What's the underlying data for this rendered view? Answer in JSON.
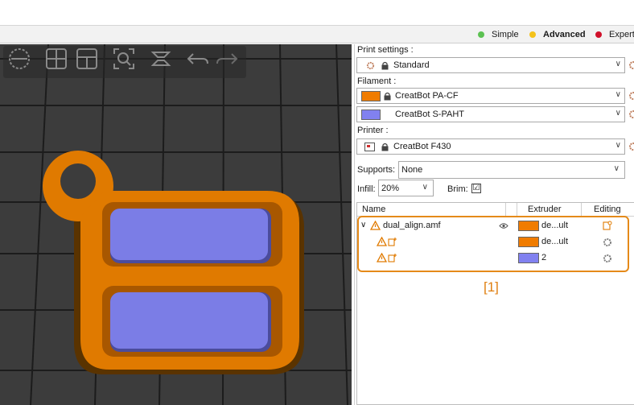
{
  "mode_bar": {
    "simple": {
      "label": "Simple",
      "color": "#5cc152"
    },
    "advanced": {
      "label": "Advanced",
      "color": "#f4c21a"
    },
    "expert": {
      "label": "Expert",
      "color": "#d0102a"
    }
  },
  "viewport": {
    "toolbar_icons": [
      "zoom-out-icon",
      "layout-grid-icon",
      "layout-split-icon",
      "zoom-to-fit-icon",
      "layers-icon",
      "undo-icon",
      "redo-icon"
    ],
    "colors": {
      "background": "#3c3c3c",
      "grid": "#1e1e1e",
      "part_orange": "#e07a00",
      "part_purple": "#7b7de6"
    }
  },
  "sidebar": {
    "print_settings": {
      "label": "Print settings :",
      "value": "Standard"
    },
    "filament": {
      "label": "Filament :",
      "items": [
        {
          "name": "CreatBot PA-CF",
          "color": "#f07c00"
        },
        {
          "name": "CreatBot S-PAHT",
          "color": "#8181f0"
        }
      ]
    },
    "printer": {
      "label": "Printer :",
      "value": "CreatBot F430"
    },
    "supports": {
      "label": "Supports:",
      "value": "None"
    },
    "infill": {
      "label": "Infill:",
      "value": "20%"
    },
    "brim": {
      "label": "Brim:",
      "checked": "☑"
    }
  },
  "object_list": {
    "columns": {
      "name": "Name",
      "extruder": "Extruder",
      "editing": "Editing"
    },
    "rows": [
      {
        "name": "dual_align.amf",
        "extruder": "de...ult",
        "color": "#f07c00"
      },
      {
        "name": "",
        "extruder": "de...ult",
        "color": "#f07c00"
      },
      {
        "name": "",
        "extruder": "2",
        "color": "#8181f0"
      }
    ]
  },
  "callout": "[1]"
}
